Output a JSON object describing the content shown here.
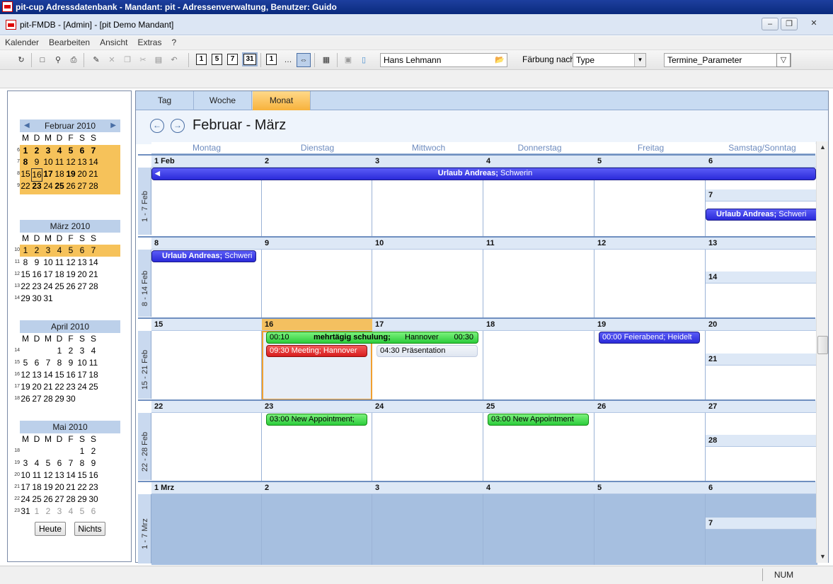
{
  "window": {
    "title": "pit-cup Adressdatenbank - Mandant: pit - Adressenverwaltung, Benutzer: Guido"
  },
  "child": {
    "title": "pit-FMDB - [Admin] - [pit Demo Mandant]"
  },
  "menu": [
    "Kalender",
    "Bearbeiten",
    "Ansicht",
    "Extras",
    "?"
  ],
  "toolbar": {
    "view_days": [
      "1",
      "5",
      "7",
      "31"
    ],
    "view_one": "1",
    "person": "Hans Lehmann",
    "faerbung_label": "Färbung nach",
    "faerbung_value": "Type",
    "filter_value": "Termine_Parameter"
  },
  "minical": [
    {
      "title": "Februar 2010"
    },
    {
      "title": "März 2010"
    },
    {
      "title": "April 2010"
    },
    {
      "title": "Mai 2010"
    }
  ],
  "dow_short": [
    "M",
    "D",
    "M",
    "D",
    "F",
    "S",
    "S"
  ],
  "buttons": {
    "today": "Heute",
    "none": "Nichts"
  },
  "tabs": [
    "Tag",
    "Woche",
    "Monat"
  ],
  "calendar": {
    "title": "Februar - März",
    "columns": [
      "Montag",
      "Dienstag",
      "Mittwoch",
      "Donnerstag",
      "Freitag",
      "Samstag/Sonntag"
    ],
    "weeks": [
      {
        "label": "1 - 7 Feb",
        "days": [
          "1 Feb",
          "2",
          "3",
          "4",
          "5",
          "6",
          "7"
        ]
      },
      {
        "label": "8 - 14 Feb",
        "days": [
          "8",
          "9",
          "10",
          "11",
          "12",
          "13",
          "14"
        ]
      },
      {
        "label": "15 - 21 Feb",
        "days": [
          "15",
          "16",
          "17",
          "18",
          "19",
          "20",
          "21"
        ]
      },
      {
        "label": "22 - 28 Feb",
        "days": [
          "22",
          "23",
          "24",
          "25",
          "26",
          "27",
          "28"
        ]
      },
      {
        "label": "1 - 7 Mrz",
        "days": [
          "1 Mrz",
          "2",
          "3",
          "4",
          "5",
          "6",
          "7"
        ]
      }
    ],
    "events": {
      "urlaub_bold": "Urlaub Andreas;",
      "urlaub_rest": " Schwerin",
      "urlaub_short_rest": " Schweri",
      "schulung_start": "00:10",
      "schulung_title": "mehrtägig schulung;",
      "schulung_place": " Hannover",
      "schulung_end": "00:30",
      "meeting": "09:30  Meeting; Hannover",
      "praesentation": "04:30  Präsentation",
      "feierabend": "00:00  Feierabend; Heidelt",
      "new_appt_23": "03:00  New Appointment;",
      "new_appt_25": "03:00  New Appointment"
    }
  },
  "status": {
    "num": "NUM"
  }
}
